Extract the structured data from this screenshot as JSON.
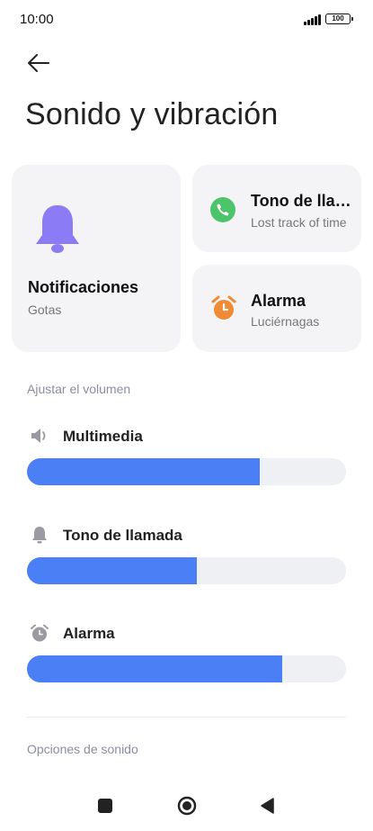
{
  "status_bar": {
    "time": "10:00",
    "battery": "100"
  },
  "header": {
    "title": "Sonido y vibración"
  },
  "cards": {
    "notifications": {
      "title": "Notificaciones",
      "subtitle": "Gotas",
      "icon": "bell-icon",
      "color": "#8b7cf5"
    },
    "ringtone": {
      "title": "Tono de llamada",
      "subtitle": "Lost track of time",
      "icon": "phone-icon",
      "color": "#4cc46a"
    },
    "alarm": {
      "title": "Alarma",
      "subtitle": "Luciérnagas",
      "icon": "alarm-clock-icon",
      "color": "#f08a35"
    }
  },
  "volume": {
    "section_label": "Ajustar el volumen",
    "accent_color": "#4a7ff5",
    "rows": [
      {
        "label": "Multimedia",
        "icon": "speaker-icon",
        "level": 0.73
      },
      {
        "label": "Tono de llamada",
        "icon": "bell-icon",
        "level": 0.533
      },
      {
        "label": "Alarma",
        "icon": "alarm-clock-icon",
        "level": 0.8
      }
    ]
  },
  "sound_options": {
    "section_label": "Opciones de sonido"
  },
  "nav_bar": {
    "icons": [
      "recents-square-icon",
      "home-circle-icon",
      "back-triangle-icon"
    ]
  }
}
